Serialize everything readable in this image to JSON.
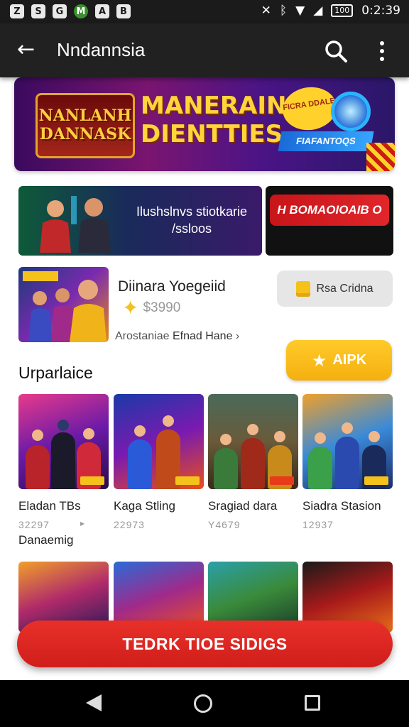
{
  "status_bar": {
    "icons": [
      "Z",
      "S",
      "G",
      "M",
      "A",
      "B"
    ],
    "time": "0:2:39",
    "battery": "100"
  },
  "app_bar": {
    "title": "Nndannsia"
  },
  "hero": {
    "logo_text": "NANLANH DANNASK",
    "title": "MANERAIN DIENTTIES..",
    "badge_text": "FICRA DDALE",
    "tag_text": "FIAFANTOQS"
  },
  "promo": {
    "text": "Ilushslnvs stiotkarie /ssloos",
    "side_button": "H BOMAOIOAIB O"
  },
  "feature": {
    "title": "Diinara Yoegeiid",
    "price": "$3990",
    "meta_prefix": "Arostaniae",
    "meta_link": "Efnad Hane",
    "store_button": "Rsa Cridna",
    "apk_button": "AIPK"
  },
  "section": {
    "title": "Urparlaice"
  },
  "games": [
    {
      "name": "Eladan TBs",
      "count": "32297"
    },
    {
      "name": "Kaga Stling",
      "count": "22973"
    },
    {
      "name": "Sragiad dara",
      "count": "Y4679"
    },
    {
      "name": "Siadra Stasion",
      "count": "12937"
    }
  ],
  "extra_label": "Danaemig",
  "cta": {
    "label": "TEDRK TIOE SIDIGS"
  },
  "colors": {
    "accent_red": "#d81e1a",
    "accent_yellow": "#f4b010",
    "appbar": "#212121"
  }
}
